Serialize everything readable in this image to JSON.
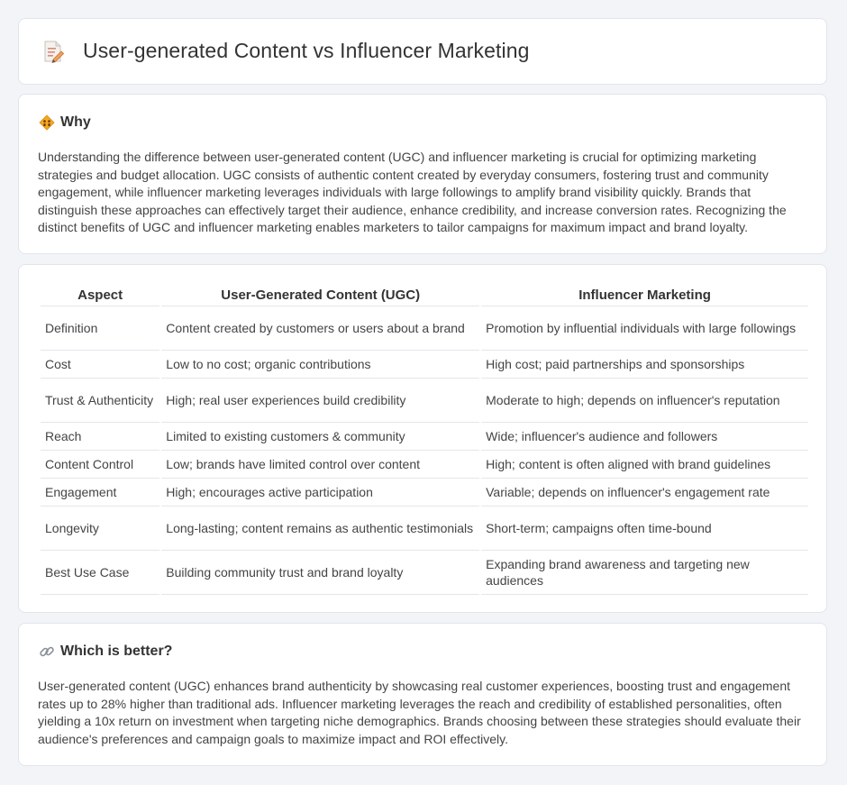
{
  "page": {
    "title": "User-generated Content vs Influencer Marketing",
    "title_icon": "document-pencil-icon"
  },
  "why": {
    "heading": "Why",
    "icon": "bright-sign-icon",
    "text": "Understanding the difference between user-generated content (UGC) and influencer marketing is crucial for optimizing marketing strategies and budget allocation. UGC consists of authentic content created by everyday consumers, fostering trust and community engagement, while influencer marketing leverages individuals with large followings to amplify brand visibility quickly. Brands that distinguish these approaches can effectively target their audience, enhance credibility, and increase conversion rates. Recognizing the distinct benefits of UGC and influencer marketing enables marketers to tailor campaigns for maximum impact and brand loyalty."
  },
  "table": {
    "headers": [
      "Aspect",
      "User-Generated Content (UGC)",
      "Influencer Marketing"
    ],
    "rows": [
      [
        "Definition",
        "Content created by customers or users about a brand",
        "Promotion by influential individuals with large followings"
      ],
      [
        "Cost",
        "Low to no cost; organic contributions",
        "High cost; paid partnerships and sponsorships"
      ],
      [
        "Trust & Authenticity",
        "High; real user experiences build credibility",
        "Moderate to high; depends on influencer's reputation"
      ],
      [
        "Reach",
        "Limited to existing customers & community",
        "Wide; influencer's audience and followers"
      ],
      [
        "Content Control",
        "Low; brands have limited control over content",
        "High; content is often aligned with brand guidelines"
      ],
      [
        "Engagement",
        "High; encourages active participation",
        "Variable; depends on influencer's engagement rate"
      ],
      [
        "Longevity",
        "Long-lasting; content remains as authentic testimonials",
        "Short-term; campaigns often time-bound"
      ],
      [
        "Best Use Case",
        "Building community trust and brand loyalty",
        "Expanding brand awareness and targeting new audiences"
      ]
    ]
  },
  "better": {
    "heading": "Which is better?",
    "icon": "link-icon",
    "text": "User-generated content (UGC) enhances brand authenticity by showcasing real customer experiences, boosting trust and engagement rates up to 28% higher than traditional ads. Influencer marketing leverages the reach and credibility of established personalities, often yielding a 10x return on investment when targeting niche demographics. Brands choosing between these strategies should evaluate their audience's preferences and campaign goals to maximize impact and ROI effectively."
  }
}
